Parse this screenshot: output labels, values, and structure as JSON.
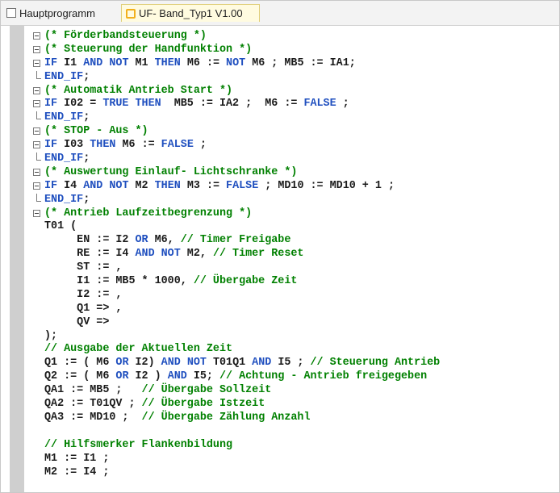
{
  "tabs": [
    {
      "label": "Hauptprogramm"
    },
    {
      "label": "UF- Band_Typ1 V1.00"
    }
  ],
  "code_lines": [
    {
      "fold": "open",
      "tokens": [
        [
          "cm",
          "(* Förderbandsteuerung *)"
        ]
      ]
    },
    {
      "fold": "open",
      "tokens": [
        [
          "cm",
          "(* Steuerung der Handfunktion *)"
        ]
      ]
    },
    {
      "fold": "open",
      "tokens": [
        [
          "kw",
          "IF"
        ],
        [
          "tx",
          " I1 "
        ],
        [
          "kw",
          "AND NOT"
        ],
        [
          "tx",
          " M1 "
        ],
        [
          "kw",
          "THEN"
        ],
        [
          "tx",
          " M6 := "
        ],
        [
          "kw",
          "NOT"
        ],
        [
          "tx",
          " M6 ; MB5 := IA1;"
        ]
      ]
    },
    {
      "fold": "end",
      "tokens": [
        [
          "kw",
          "END_IF"
        ],
        [
          "tx",
          ";"
        ]
      ]
    },
    {
      "fold": "open",
      "tokens": [
        [
          "cm",
          "(* Automatik Antrieb Start *)"
        ]
      ]
    },
    {
      "fold": "open",
      "tokens": [
        [
          "kw",
          "IF"
        ],
        [
          "tx",
          " I02 = "
        ],
        [
          "kw",
          "TRUE THEN"
        ],
        [
          "tx",
          "  MB5 := IA2 ;  M6 := "
        ],
        [
          "kw",
          "FALSE"
        ],
        [
          "tx",
          " ;"
        ]
      ]
    },
    {
      "fold": "end",
      "tokens": [
        [
          "kw",
          "END_IF"
        ],
        [
          "tx",
          ";"
        ]
      ]
    },
    {
      "fold": "open",
      "tokens": [
        [
          "cm",
          "(* STOP - Aus *)"
        ]
      ]
    },
    {
      "fold": "open",
      "tokens": [
        [
          "kw",
          "IF"
        ],
        [
          "tx",
          " I03 "
        ],
        [
          "kw",
          "THEN"
        ],
        [
          "tx",
          " M6 := "
        ],
        [
          "kw",
          "FALSE"
        ],
        [
          "tx",
          " ;"
        ]
      ]
    },
    {
      "fold": "end",
      "tokens": [
        [
          "kw",
          "END_IF"
        ],
        [
          "tx",
          ";"
        ]
      ]
    },
    {
      "fold": "open",
      "tokens": [
        [
          "cm",
          "(* Auswertung Einlauf- Lichtschranke *)"
        ]
      ]
    },
    {
      "fold": "open",
      "tokens": [
        [
          "kw",
          "IF"
        ],
        [
          "tx",
          " I4 "
        ],
        [
          "kw",
          "AND NOT"
        ],
        [
          "tx",
          " M2 "
        ],
        [
          "kw",
          "THEN"
        ],
        [
          "tx",
          " M3 := "
        ],
        [
          "kw",
          "FALSE"
        ],
        [
          "tx",
          " ; MD10 := MD10 + 1 ;"
        ]
      ]
    },
    {
      "fold": "end",
      "tokens": [
        [
          "kw",
          "END_IF"
        ],
        [
          "tx",
          ";"
        ]
      ]
    },
    {
      "fold": "open",
      "tokens": [
        [
          "cm",
          "(* Antrieb Laufzeitbegrenzung *)"
        ]
      ]
    },
    {
      "fold": "none",
      "tokens": [
        [
          "tx",
          "T01 ("
        ]
      ]
    },
    {
      "fold": "none",
      "tokens": [
        [
          "tx",
          "     EN := I2 "
        ],
        [
          "kw",
          "OR"
        ],
        [
          "tx",
          " M6, "
        ],
        [
          "cm",
          "// Timer Freigabe"
        ]
      ]
    },
    {
      "fold": "none",
      "tokens": [
        [
          "tx",
          "     RE := I4 "
        ],
        [
          "kw",
          "AND NOT"
        ],
        [
          "tx",
          " M2, "
        ],
        [
          "cm",
          "// Timer Reset"
        ]
      ]
    },
    {
      "fold": "none",
      "tokens": [
        [
          "tx",
          "     ST := ,"
        ]
      ]
    },
    {
      "fold": "none",
      "tokens": [
        [
          "tx",
          "     I1 := MB5 * 1000, "
        ],
        [
          "cm",
          "// Übergabe Zeit"
        ]
      ]
    },
    {
      "fold": "none",
      "tokens": [
        [
          "tx",
          "     I2 := ,"
        ]
      ]
    },
    {
      "fold": "none",
      "tokens": [
        [
          "tx",
          "     Q1 => ,"
        ]
      ]
    },
    {
      "fold": "none",
      "tokens": [
        [
          "tx",
          "     QV =>"
        ]
      ]
    },
    {
      "fold": "none",
      "tokens": [
        [
          "tx",
          ");"
        ]
      ]
    },
    {
      "fold": "none",
      "tokens": [
        [
          "cm",
          "// Ausgabe der Aktuellen Zeit"
        ]
      ]
    },
    {
      "fold": "none",
      "tokens": [
        [
          "tx",
          "Q1 := ( M6 "
        ],
        [
          "kw",
          "OR"
        ],
        [
          "tx",
          " I2) "
        ],
        [
          "kw",
          "AND NOT"
        ],
        [
          "tx",
          " T01Q1 "
        ],
        [
          "kw",
          "AND"
        ],
        [
          "tx",
          " I5 ; "
        ],
        [
          "cm",
          "// Steuerung Antrieb"
        ]
      ]
    },
    {
      "fold": "none",
      "tokens": [
        [
          "tx",
          "Q2 := ( M6 "
        ],
        [
          "kw",
          "OR"
        ],
        [
          "tx",
          " I2 ) "
        ],
        [
          "kw",
          "AND"
        ],
        [
          "tx",
          " I5; "
        ],
        [
          "cm",
          "// Achtung - Antrieb freigegeben"
        ]
      ]
    },
    {
      "fold": "none",
      "tokens": [
        [
          "tx",
          "QA1 := MB5 ;   "
        ],
        [
          "cm",
          "// Übergabe Sollzeit"
        ]
      ]
    },
    {
      "fold": "none",
      "tokens": [
        [
          "tx",
          "QA2 := T01QV ; "
        ],
        [
          "cm",
          "// Übergabe Istzeit"
        ]
      ]
    },
    {
      "fold": "none",
      "tokens": [
        [
          "tx",
          "QA3 := MD10 ;  "
        ],
        [
          "cm",
          "// Übergabe Zählung Anzahl"
        ]
      ]
    },
    {
      "fold": "none",
      "tokens": [
        [
          "tx",
          ""
        ]
      ]
    },
    {
      "fold": "none",
      "tokens": [
        [
          "cm",
          "// Hilfsmerker Flankenbildung"
        ]
      ]
    },
    {
      "fold": "none",
      "tokens": [
        [
          "tx",
          "M1 := I1 ;"
        ]
      ]
    },
    {
      "fold": "none",
      "tokens": [
        [
          "tx",
          "M2 := I4 ;"
        ]
      ]
    }
  ],
  "colors": {
    "comment": "#008000",
    "keyword": "#1f4fbf",
    "text": "#1a1a1a",
    "gutter": "#cfcfcf"
  }
}
